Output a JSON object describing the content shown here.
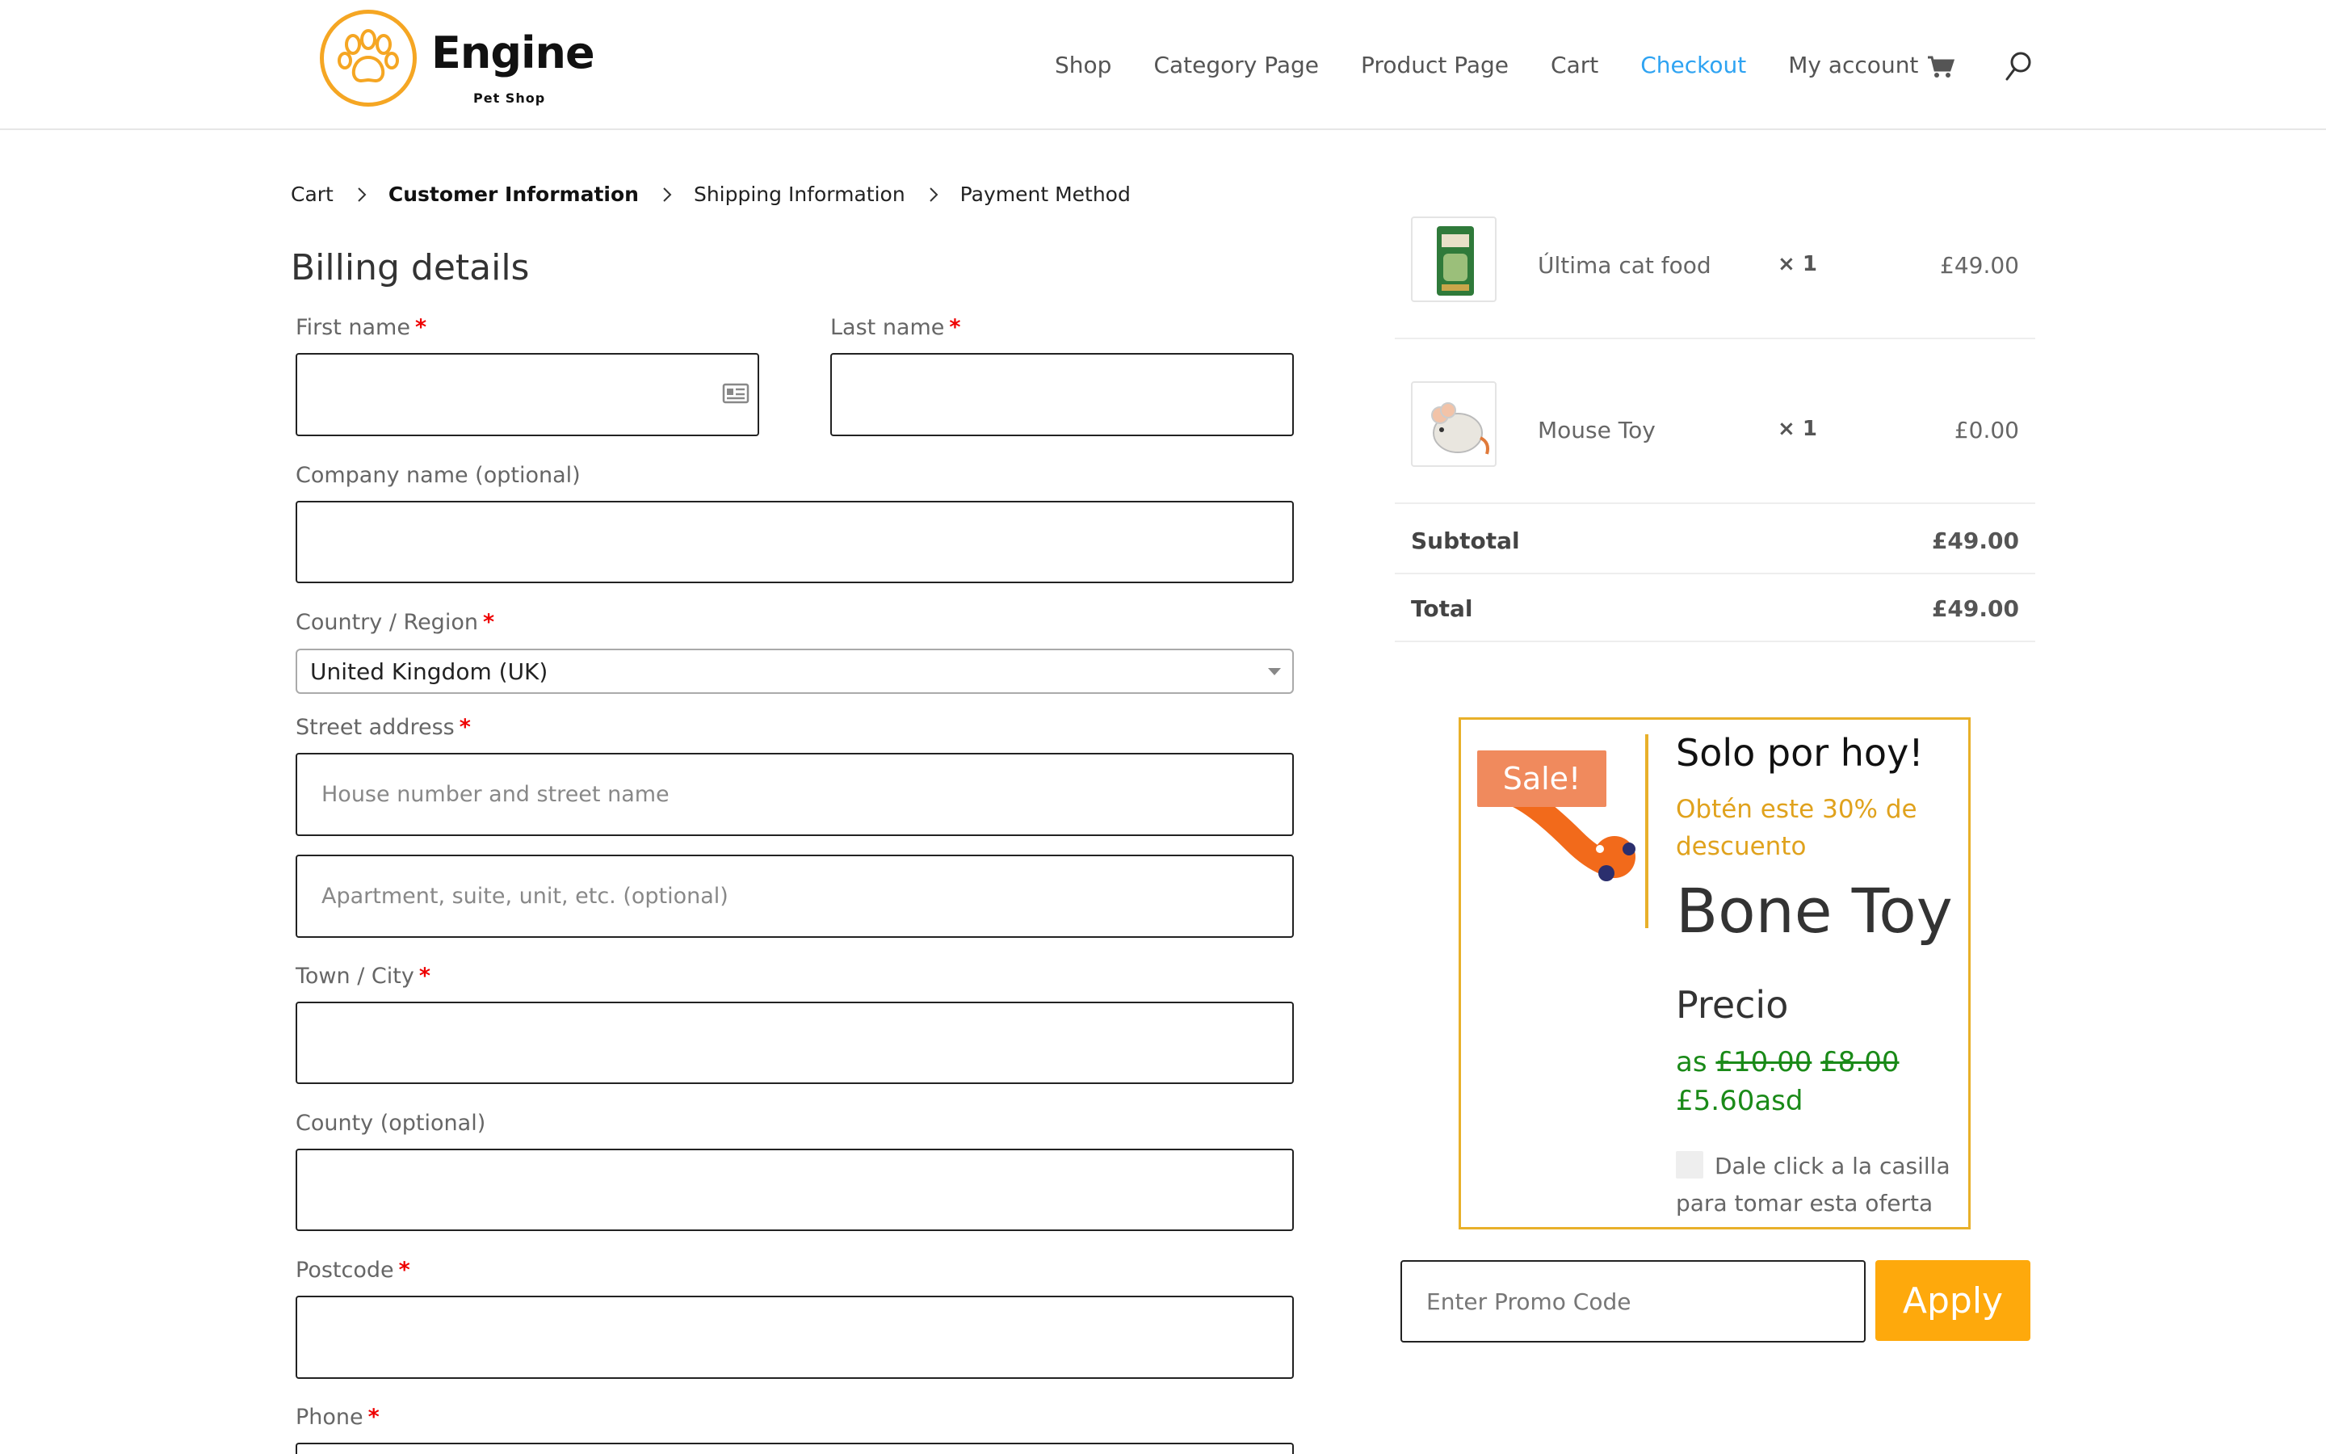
{
  "brand": {
    "name": "Engine",
    "tagline": "Pet Shop",
    "logo_icon": "paw-icon",
    "accent": "#f5a623"
  },
  "nav": {
    "items": [
      {
        "label": "Shop",
        "active": false
      },
      {
        "label": "Category Page",
        "active": false
      },
      {
        "label": "Product Page",
        "active": false
      },
      {
        "label": "Cart",
        "active": false
      },
      {
        "label": "Checkout",
        "active": true
      },
      {
        "label": "My account",
        "active": false
      }
    ],
    "active_color": "#2ea3f2",
    "cart_icon": "shopping-cart-icon",
    "search_icon": "search-icon"
  },
  "breadcrumb": {
    "steps": [
      "Cart",
      "Customer Information",
      "Shipping Information",
      "Payment Method"
    ],
    "current_index": 1
  },
  "billing": {
    "title": "Billing details",
    "required_mark": "*",
    "fields": {
      "first_name": {
        "label": "First name",
        "required": true,
        "value": "",
        "placeholder": ""
      },
      "last_name": {
        "label": "Last name",
        "required": true,
        "value": "",
        "placeholder": ""
      },
      "company": {
        "label": "Company name (optional)",
        "required": false,
        "value": "",
        "placeholder": ""
      },
      "country": {
        "label": "Country / Region",
        "required": true,
        "value": "United Kingdom (UK)"
      },
      "street": {
        "label": "Street address",
        "required": true,
        "placeholder": "House number and street name",
        "placeholder2": "Apartment, suite, unit, etc. (optional)"
      },
      "town": {
        "label": "Town / City",
        "required": true,
        "value": ""
      },
      "county": {
        "label": "County (optional)",
        "required": false,
        "value": ""
      },
      "postcode": {
        "label": "Postcode",
        "required": true,
        "value": ""
      },
      "phone": {
        "label": "Phone",
        "required": true,
        "value": ""
      }
    }
  },
  "order": {
    "items": [
      {
        "name": "Última cat food",
        "qty": "× 1",
        "price": "£49.00"
      },
      {
        "name": "Mouse Toy",
        "qty": "× 1",
        "price": "£0.00"
      }
    ],
    "subtotal_label": "Subtotal",
    "subtotal": "£49.00",
    "total_label": "Total",
    "total": "£49.00"
  },
  "offer": {
    "badge": "Sale!",
    "title": "Solo por hoy!",
    "subtitle": "Obtén este 30% de descuento",
    "product": "Bone Toy",
    "price_label": "Precio",
    "price_prefix": "as",
    "price_old1": "£10.00",
    "price_old2": "£8.00",
    "price_new": "£5.60asd",
    "checkbox_label": "Dale click a la casilla para tomar esta oferta",
    "border_color": "#e8b02a",
    "badge_color": "#f08a5d"
  },
  "promo": {
    "placeholder": "Enter Promo Code",
    "button": "Apply",
    "button_color": "#fea90c"
  }
}
